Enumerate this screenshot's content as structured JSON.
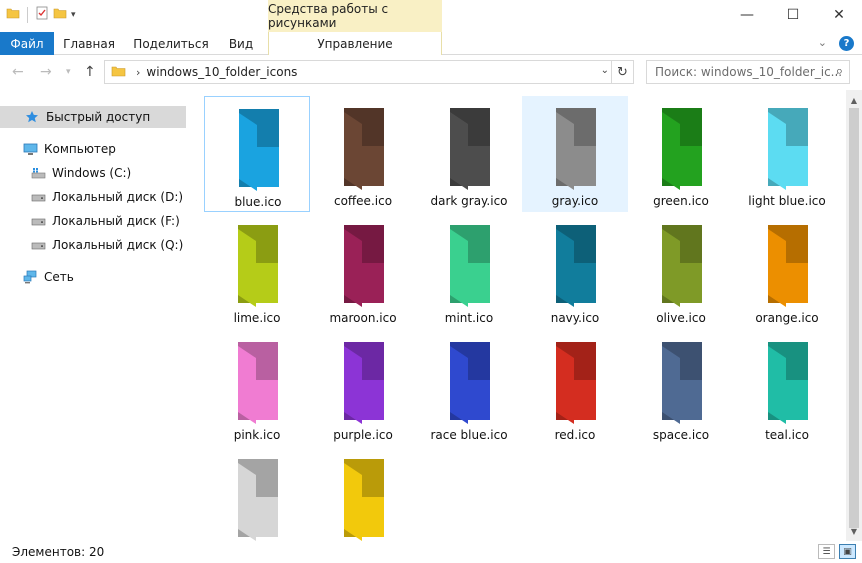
{
  "titlebar": {
    "contextual_tab_title": "Средства работы с рисунками",
    "minimize": "—",
    "maximize": "☐",
    "close": "✕"
  },
  "ribbon": {
    "tabs": [
      "Файл",
      "Главная",
      "Поделиться",
      "Вид",
      "Управление"
    ]
  },
  "address": {
    "path": "windows_10_folder_icons",
    "search_placeholder": "Поиск: windows_10_folder_ic..."
  },
  "navpane": {
    "quick_access": "Быстрый доступ",
    "computer": "Компьютер",
    "drives": [
      "Windows (C:)",
      "Локальный диск (D:)",
      "Локальный диск (F:)",
      "Локальный диск (Q:)"
    ],
    "network": "Сеть"
  },
  "files": [
    {
      "name": "blue.ico",
      "color": "#1aa3e0"
    },
    {
      "name": "coffee.ico",
      "color": "#6b4634"
    },
    {
      "name": "dark gray.ico",
      "color": "#4d4d4d"
    },
    {
      "name": "gray.ico",
      "color": "#8c8c8c"
    },
    {
      "name": "green.ico",
      "color": "#23a21f"
    },
    {
      "name": "light blue.ico",
      "color": "#5cdcf2"
    },
    {
      "name": "lime.ico",
      "color": "#b5cc18"
    },
    {
      "name": "maroon.ico",
      "color": "#9a2157"
    },
    {
      "name": "mint.ico",
      "color": "#3ad08f"
    },
    {
      "name": "navy.ico",
      "color": "#117d9c"
    },
    {
      "name": "olive.ico",
      "color": "#7f9a27"
    },
    {
      "name": "orange.ico",
      "color": "#ec8f00"
    },
    {
      "name": "pink.ico",
      "color": "#f07cd2"
    },
    {
      "name": "purple.ico",
      "color": "#8c34d6"
    },
    {
      "name": "race blue.ico",
      "color": "#2f49cf"
    },
    {
      "name": "red.ico",
      "color": "#d42d20"
    },
    {
      "name": "space.ico",
      "color": "#4f6a93"
    },
    {
      "name": "teal.ico",
      "color": "#20bda6"
    },
    {
      "name": "",
      "color": "#d6d6d6"
    },
    {
      "name": "",
      "color": "#f2c90c"
    }
  ],
  "selected_file_index": 3,
  "focused_file_index": 0,
  "status": {
    "count": "Элементов: 20"
  }
}
